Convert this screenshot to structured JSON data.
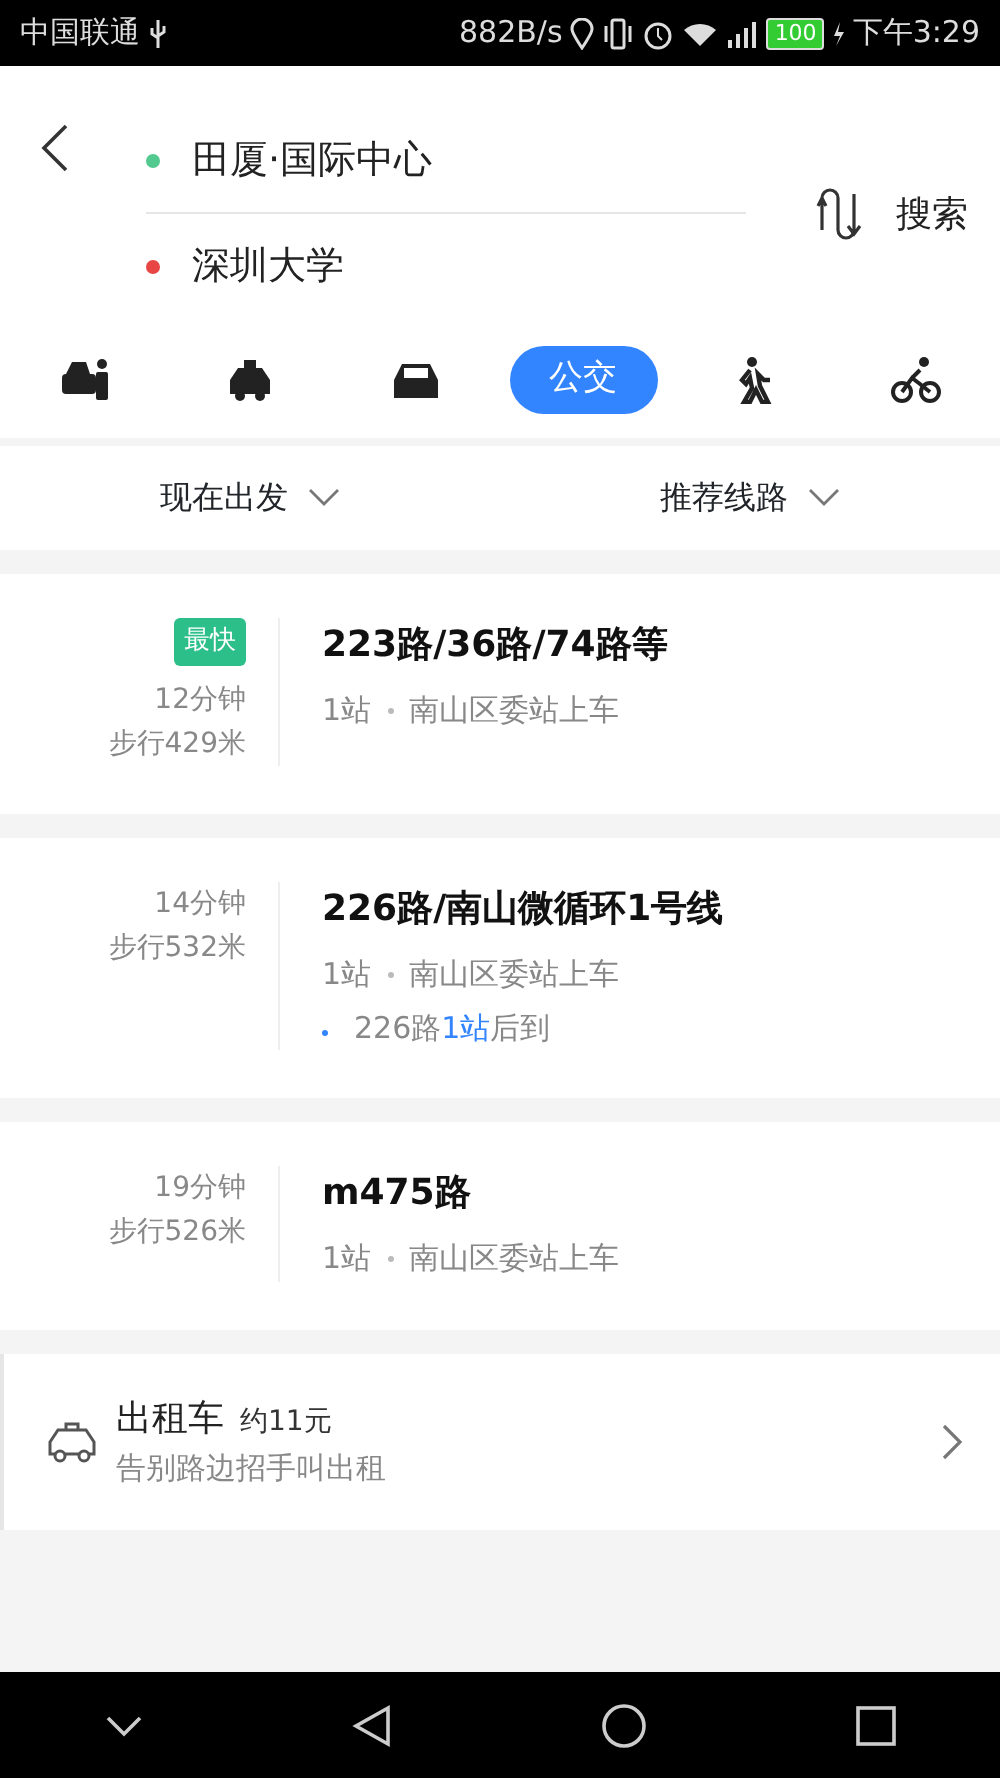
{
  "status_bar": {
    "carrier": "中国联通",
    "speed": "882B/s",
    "battery": "100",
    "time": "下午3:29"
  },
  "route": {
    "origin": "田厦·国际中心",
    "destination": "深圳大学",
    "search": "搜索"
  },
  "modes": [
    {
      "kind": "ride",
      "selected": false
    },
    {
      "kind": "taxi",
      "selected": false
    },
    {
      "kind": "car",
      "selected": false
    },
    {
      "kind": "bus",
      "label": "公交",
      "selected": true
    },
    {
      "kind": "walk",
      "selected": false
    },
    {
      "kind": "bike",
      "selected": false
    }
  ],
  "filters": [
    "现在出发",
    "推荐线路"
  ],
  "routes": [
    {
      "badge": "最快",
      "duration": "12分钟",
      "walk": "步行429米",
      "name": "223路/36路/74路等",
      "stops": "1站",
      "boarding": "南山区委站上车"
    },
    {
      "duration": "14分钟",
      "walk": "步行532米",
      "name": "226路/南山微循环1号线",
      "stops": "1站",
      "boarding": "南山区委站上车",
      "arrival": {
        "line": "226路",
        "count": "1站",
        "suffix": "后到"
      }
    },
    {
      "duration": "19分钟",
      "walk": "步行526米",
      "name": "m475路",
      "stops": "1站",
      "boarding": "南山区委站上车"
    }
  ],
  "taxi": {
    "title": "出租车",
    "price": "约11元",
    "subtitle": "告别路边招手叫出租"
  }
}
